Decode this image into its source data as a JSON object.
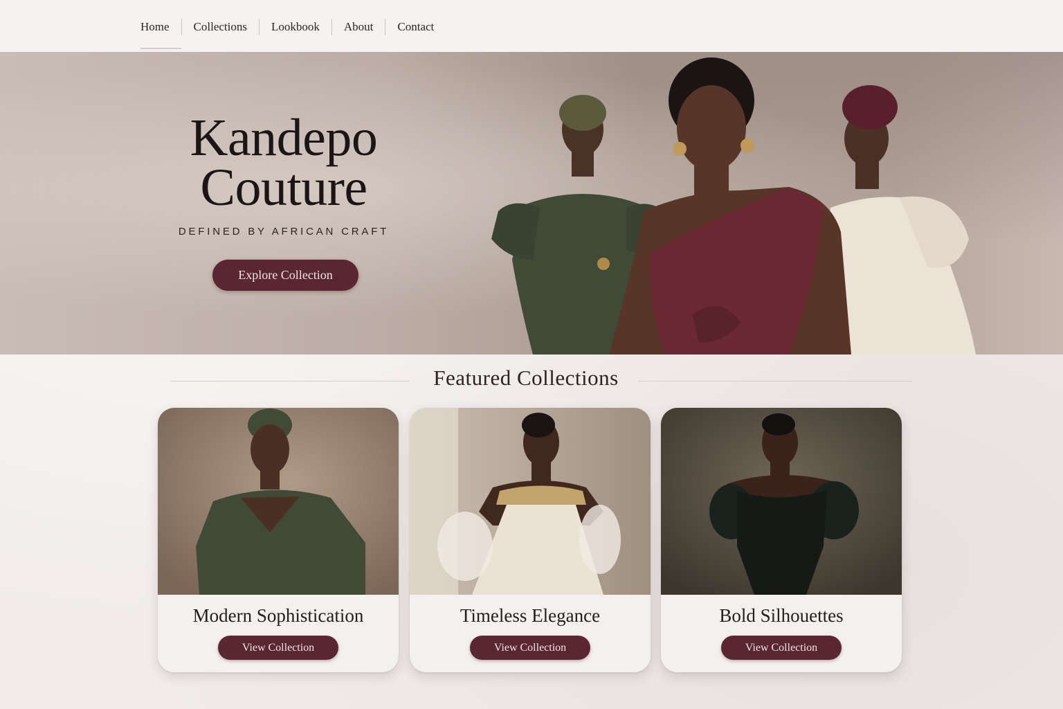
{
  "nav": {
    "items": [
      {
        "label": "Home",
        "active": true
      },
      {
        "label": "Collections"
      },
      {
        "label": "Lookbook"
      },
      {
        "label": "About"
      },
      {
        "label": "Contact"
      }
    ]
  },
  "hero": {
    "title_line1": "Kandepo",
    "title_line2": "Couture",
    "tagline": "DEFINED BY AFRICAN CRAFT",
    "cta_label": "Explore Collection"
  },
  "featured": {
    "heading": "Featured Collections",
    "cards": [
      {
        "title": "Modern Sophistication",
        "button": "View Collection",
        "dress_color": "#3f4a36"
      },
      {
        "title": "Timeless Elegance",
        "button": "View Collection",
        "dress_color": "#ece2d3"
      },
      {
        "title": "Bold Silhouettes",
        "button": "View Collection",
        "dress_color": "#151a17"
      }
    ]
  },
  "colors": {
    "accent": "#5a2632",
    "background": "#f1eceb",
    "burgundy_gown": "#6b2a33",
    "olive_gown": "#414a37",
    "ivory_gown": "#ece2d6"
  }
}
